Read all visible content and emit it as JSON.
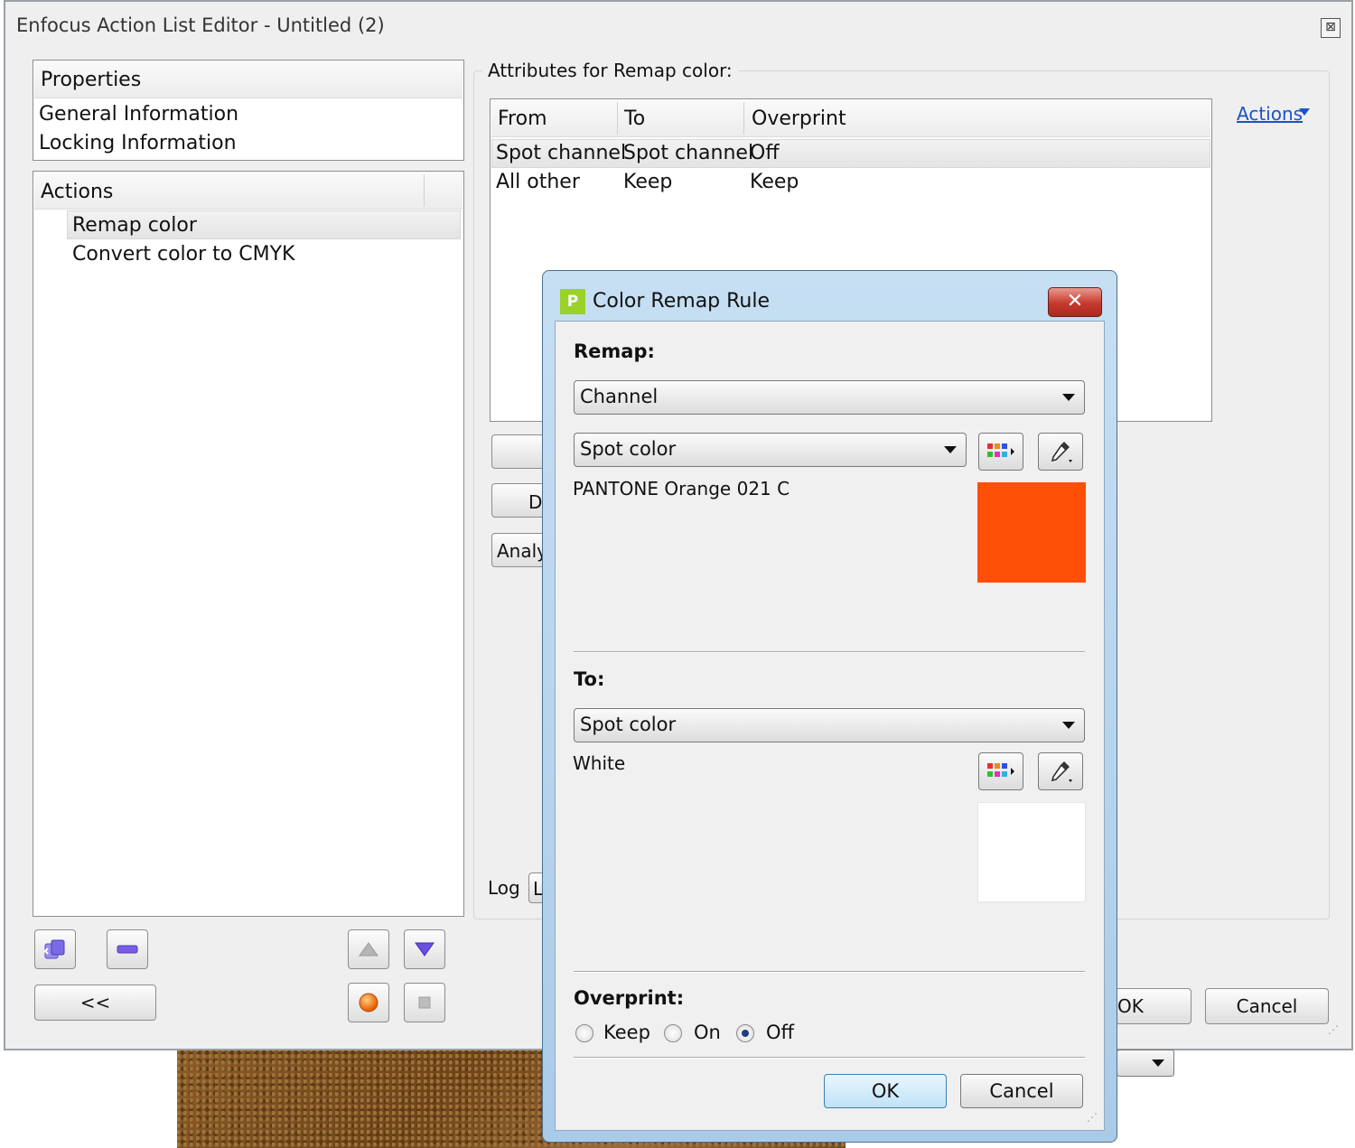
{
  "window": {
    "title": "Enfocus Action List Editor - Untitled (2)",
    "close_glyph": "⊠"
  },
  "properties": {
    "title": "Properties",
    "items": [
      "General Information",
      "Locking Information"
    ]
  },
  "actions_panel": {
    "title": "Actions",
    "items": [
      "Remap color",
      "Convert color to CMYK"
    ],
    "collapse_label": "<<"
  },
  "attributes": {
    "title": "Attributes for Remap color:",
    "actions_menu": "Actions",
    "columns": [
      "From",
      "To",
      "Overprint"
    ],
    "rows": [
      [
        "Spot channel",
        "Spot channel",
        "Off"
      ],
      [
        "All other",
        "Keep",
        "Keep"
      ]
    ],
    "partial_button_2": "D",
    "partial_button_3": "Analy",
    "log_label": "Log",
    "log_value": "L"
  },
  "main_buttons": {
    "ok": "OK",
    "cancel": "Cancel"
  },
  "dialog": {
    "title": "Color Remap Rule",
    "app_icon_text": "P",
    "close_glyph": "✕",
    "remap_label": "Remap:",
    "remap_value": "Channel",
    "from_type": "Spot color",
    "from_color_name": "PANTONE Orange 021 C",
    "to_label": "To:",
    "to_type": "Spot color",
    "to_color_name": "White",
    "overprint_label": "Overprint:",
    "overprint_options": [
      "Keep",
      "On",
      "Off"
    ],
    "overprint_selected": "Off",
    "ok_label": "OK",
    "cancel_label": "Cancel"
  },
  "colors": {
    "from_swatch": "#ff4f07",
    "to_swatch": "#ffffff",
    "link": "#1a52c7",
    "selection": "#e8e8e8"
  },
  "icons": {
    "add": "add-action-icon",
    "remove": "remove-action-icon",
    "up": "move-up-icon",
    "down": "move-down-icon",
    "record": "record-icon",
    "stop": "stop-icon",
    "swatch_picker": "color-swatch-icon",
    "eyedropper": "eyedropper-icon"
  }
}
